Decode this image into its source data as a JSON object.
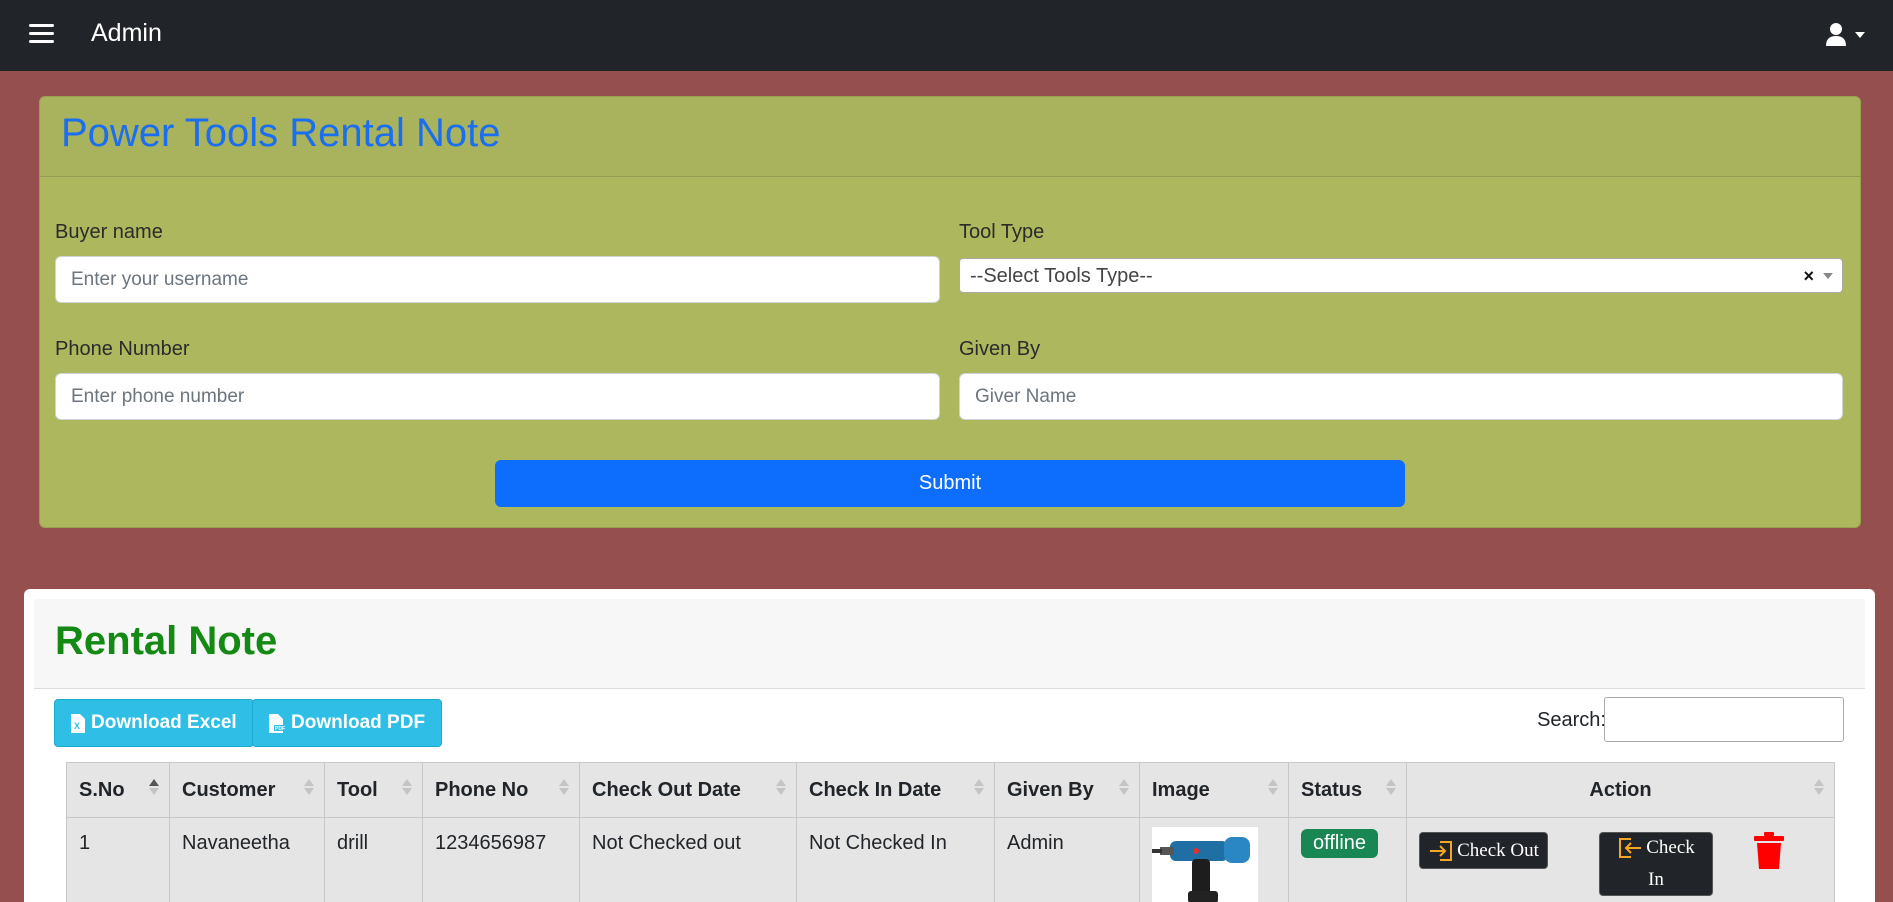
{
  "navbar": {
    "brand": "Admin",
    "menu_icon": "hamburger-icon",
    "user_icon": "user-icon"
  },
  "form": {
    "title": "Power Tools Rental Note",
    "buyer_label": "Buyer name",
    "buyer_placeholder": "Enter your username",
    "tool_label": "Tool Type",
    "tool_selected": "--Select Tools Type--",
    "phone_label": "Phone Number",
    "phone_placeholder": "Enter phone number",
    "given_label": "Given By",
    "given_placeholder": "Giver Name",
    "submit_label": "Submit"
  },
  "table": {
    "title": "Rental Note",
    "excel_label": "Download Excel",
    "pdf_label": "Download PDF",
    "search_label": "Search:",
    "columns": [
      "S.No",
      "Customer",
      "Tool",
      "Phone No",
      "Check Out Date",
      "Check In Date",
      "Given By",
      "Image",
      "Status",
      "Action"
    ],
    "rows": [
      {
        "sno": "1",
        "customer": "Navaneetha",
        "tool": "drill",
        "phone": "1234656987",
        "checkout": "Not Checked out",
        "checkin": "Not Checked In",
        "given_by": "Admin",
        "status": "offline",
        "checkout_btn": "Check Out",
        "checkin_btn_line1": "Check",
        "checkin_btn_line2": "In"
      }
    ]
  },
  "colors": {
    "page_bg": "#964f4f",
    "navbar_bg": "#212529",
    "form_bg": "#adb75e",
    "form_title": "#1a6ef0",
    "submit_bg": "#0d6efd",
    "table_title": "#148a14",
    "export_bg": "#2fbfe6",
    "status_bg": "#198754",
    "delete_icon": "#ff0000"
  }
}
